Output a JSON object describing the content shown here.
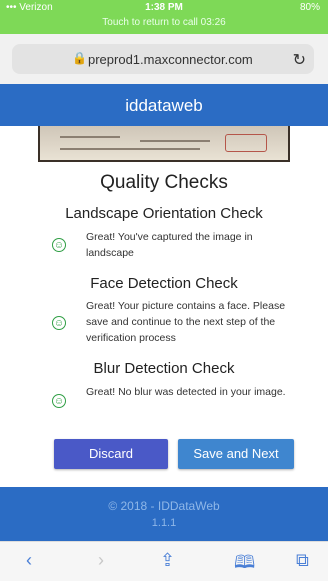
{
  "status_bar": {
    "carrier": "••• Verizon",
    "time": "1:38 PM",
    "battery": "80%",
    "banner": "Touch to return to call 03:26"
  },
  "browser": {
    "url": "preprod1.maxconnector.com"
  },
  "app": {
    "brand": "iddataweb"
  },
  "quality": {
    "title": "Quality Checks",
    "checks": [
      {
        "heading": "Landscape Orientation Check",
        "text": "Great! You've captured the image in landscape"
      },
      {
        "heading": "Face Detection Check",
        "text": "Great! Your picture contains a face. Please save and continue to the next step of the verification process"
      },
      {
        "heading": "Blur Detection Check",
        "text": "Great! No blur was detected in your image."
      }
    ]
  },
  "actions": {
    "discard": "Discard",
    "save_next": "Save and Next"
  },
  "footer": {
    "copyright": "© 2018 - IDDataWeb",
    "version": "1.1.1"
  },
  "icons": {
    "check": "smiley-check-icon",
    "back": "back-arrow-icon",
    "forward": "forward-arrow-icon",
    "share": "share-icon",
    "bookmarks": "bookmarks-icon",
    "tabs": "tabs-icon"
  }
}
